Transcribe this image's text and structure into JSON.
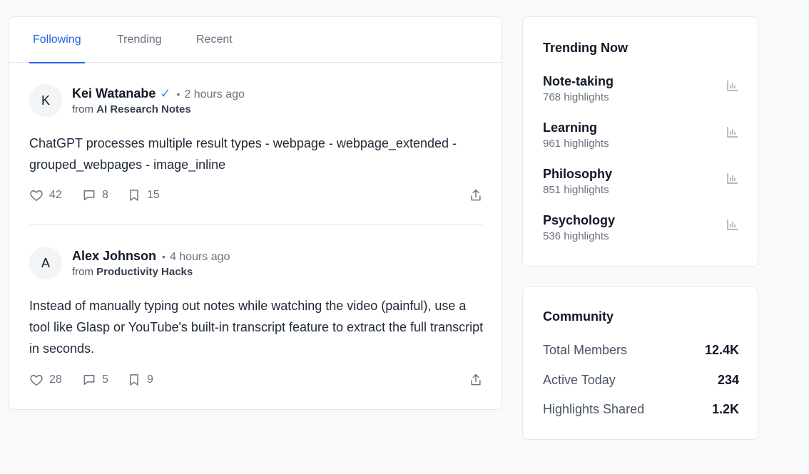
{
  "feed": {
    "tabs": [
      {
        "label": "Following",
        "active": true
      },
      {
        "label": "Trending",
        "active": false
      },
      {
        "label": "Recent",
        "active": false
      }
    ],
    "posts": [
      {
        "avatar_initial": "K",
        "author": "Kei Watanabe",
        "verified_mark": "✓",
        "separator": "•",
        "time": "2 hours ago",
        "source_prefix": "from",
        "source": "AI Research Notes",
        "text": "ChatGPT processes multiple result types - webpage - webpage_extended - grouped_webpages - image_inline",
        "likes": "42",
        "comments": "8",
        "bookmarks": "15"
      },
      {
        "avatar_initial": "A",
        "author": "Alex Johnson",
        "separator": "•",
        "time": "4 hours ago",
        "source_prefix": "from",
        "source": "Productivity Hacks",
        "text": "Instead of manually typing out notes while watching the video (painful), use a tool like Glasp or YouTube's built-in transcript feature to extract the full transcript in seconds.",
        "likes": "28",
        "comments": "5",
        "bookmarks": "9"
      }
    ]
  },
  "trending": {
    "title": "Trending Now",
    "items": [
      {
        "name": "Note-taking",
        "count": "768 highlights"
      },
      {
        "name": "Learning",
        "count": "961 highlights"
      },
      {
        "name": "Philosophy",
        "count": "851 highlights"
      },
      {
        "name": "Psychology",
        "count": "536 highlights"
      }
    ]
  },
  "community": {
    "title": "Community",
    "stats": [
      {
        "label": "Total Members",
        "value": "12.4K"
      },
      {
        "label": "Active Today",
        "value": "234"
      },
      {
        "label": "Highlights Shared",
        "value": "1.2K"
      }
    ]
  },
  "colors": {
    "accent": "#2563eb",
    "verified": "#3b82f6",
    "muted": "#6b7280"
  }
}
